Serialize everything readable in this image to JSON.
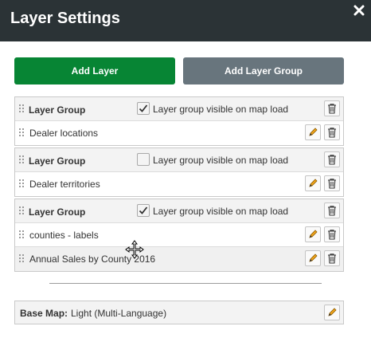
{
  "window": {
    "title": "Layer Settings",
    "close_icon": "close-icon"
  },
  "toolbar": {
    "add_layer_label": "Add Layer",
    "add_layer_group_label": "Add Layer Group",
    "add_layer_color": "#078534",
    "add_layer_group_color": "#68757d"
  },
  "groups": [
    {
      "label": "Layer Group",
      "visible_checkbox_label": "Layer group visible on map load",
      "visible_checked": true,
      "layers": [
        {
          "name": "Dealer locations"
        }
      ]
    },
    {
      "label": "Layer Group",
      "visible_checkbox_label": "Layer group visible on map load",
      "visible_checked": false,
      "layers": [
        {
          "name": "Dealer territories"
        }
      ]
    },
    {
      "label": "Layer Group",
      "visible_checkbox_label": "Layer group visible on map load",
      "visible_checked": true,
      "layers": [
        {
          "name": "counties - labels"
        },
        {
          "name": "Annual Sales by County 2016"
        }
      ]
    }
  ],
  "basemap": {
    "label": "Base Map:",
    "value": "Light (Multi-Language)"
  }
}
